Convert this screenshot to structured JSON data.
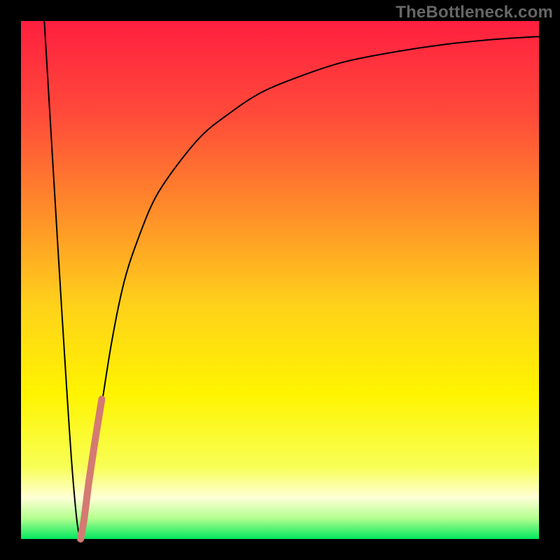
{
  "watermark": "TheBottleneck.com",
  "frame": {
    "outer_size": 800,
    "border": 30,
    "border_color": "#000000"
  },
  "gradient_stops": [
    {
      "offset": 0.0,
      "color": "#ff1f3f"
    },
    {
      "offset": 0.18,
      "color": "#ff4a3a"
    },
    {
      "offset": 0.36,
      "color": "#ff8a2a"
    },
    {
      "offset": 0.55,
      "color": "#ffd21a"
    },
    {
      "offset": 0.72,
      "color": "#fff400"
    },
    {
      "offset": 0.86,
      "color": "#f8ff55"
    },
    {
      "offset": 0.92,
      "color": "#ffffd6"
    },
    {
      "offset": 0.96,
      "color": "#b4ff90"
    },
    {
      "offset": 1.0,
      "color": "#00e75d"
    }
  ],
  "chart_data": {
    "type": "line",
    "title": "",
    "xlabel": "",
    "ylabel": "",
    "xlim": [
      0,
      100
    ],
    "ylim": [
      0,
      100
    ],
    "grid": false,
    "series": [
      {
        "name": "bottleneck-curve",
        "color": "#000000",
        "stroke_width": 2,
        "x": [
          4.5,
          6,
          8,
          10,
          11.5,
          13,
          15,
          17.5,
          20,
          23,
          26,
          30,
          35,
          40,
          46,
          53,
          62,
          72,
          82,
          92,
          100
        ],
        "y": [
          100,
          75,
          42,
          12,
          0,
          8,
          22,
          38,
          50,
          59,
          66,
          72,
          78,
          82,
          86,
          89,
          92,
          94,
          95.5,
          96.5,
          97
        ]
      },
      {
        "name": "highlight-segment",
        "color": "#d47a72",
        "stroke_width": 10,
        "x": [
          11.5,
          12.2,
          13.1,
          14.3,
          15.6
        ],
        "y": [
          0,
          4,
          11,
          19,
          27
        ]
      }
    ],
    "annotations": []
  }
}
